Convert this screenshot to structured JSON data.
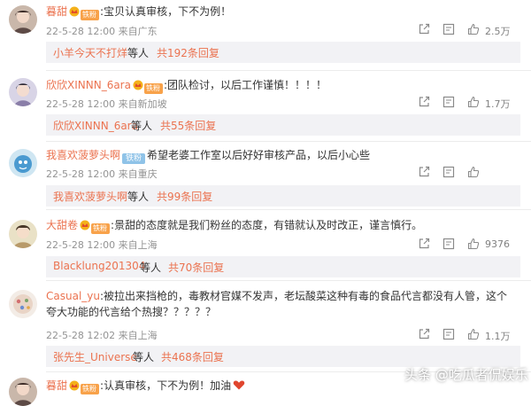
{
  "comments": [
    {
      "user": "暮甜",
      "fan_badge": "铁粉",
      "sep": ":",
      "text": "宝贝认真审核，下不为例！",
      "time": "22-5-28 12:00",
      "location": "来自广东",
      "likes": "2.5万",
      "reply_user": "小羊今天不打烊",
      "reply_mid": "等人",
      "reply_total": "共192条回复"
    },
    {
      "user": "欣欣XINNN_6ara",
      "fan_badge": "铁粉",
      "sep": ":",
      "text": "团队检讨，以后工作谨慎！！！！",
      "time": "22-5-28 12:00",
      "location": "来自新加坡",
      "likes": "1.7万",
      "reply_user": "欣欣XINNN_6ara",
      "reply_mid": "等人",
      "reply_total": "共55条回复"
    },
    {
      "user": "我喜欢菠萝头啊",
      "fan_badge": "铁粉",
      "sep": "",
      "text": "希望老婆工作室以后好好审核产品，以后小心些",
      "time": "22-5-28 12:00",
      "location": "来自重庆",
      "likes": "",
      "reply_user": "我喜欢菠萝头啊",
      "reply_mid": "等人",
      "reply_total": "共99条回复"
    },
    {
      "user": "大甜卷",
      "fan_badge": "铁粉",
      "sep": ":",
      "text": "景甜的态度就是我们粉丝的态度，有错就认及时改正，谨言慎行。",
      "time": "22-5-28 12:00",
      "location": "来自上海",
      "likes": "9376",
      "reply_user": "Blacklung201304",
      "reply_mid": "等人",
      "reply_total": "共70条回复"
    },
    {
      "user": "Casual_yu",
      "fan_badge": "",
      "sep": ":",
      "text": "被拉出来挡枪的，毒教材官媒不发声，老坛酸菜这种有毒的食品代言都没有人管，这个夸大功能的代言给个热搜？？？？？",
      "time": "22-5-28 12:02",
      "location": "来自上海",
      "likes": "1.1万",
      "reply_user": "张先生_Universe",
      "reply_mid": "等人",
      "reply_total": "共468条回复"
    },
    {
      "user": "暮甜",
      "fan_badge": "铁粉",
      "sep": ":",
      "text": "认真审核，下不为例！加油",
      "time": "",
      "location": "",
      "likes": "",
      "reply_user": "",
      "reply_mid": "",
      "reply_total": ""
    }
  ],
  "watermark": {
    "text": "头条 @吃瓜者侃娱乐"
  },
  "icons": [
    "share-icon",
    "comment-icon",
    "like-icon",
    "heart-icon",
    "vip-crown-icon"
  ],
  "colors": {
    "username": "#eb7350",
    "text": "#333333",
    "meta": "#939393",
    "reply_bg": "#f2f2f5",
    "fan_badge": "#f8a24a",
    "fan_badge_blue": "#8fc3e8"
  }
}
